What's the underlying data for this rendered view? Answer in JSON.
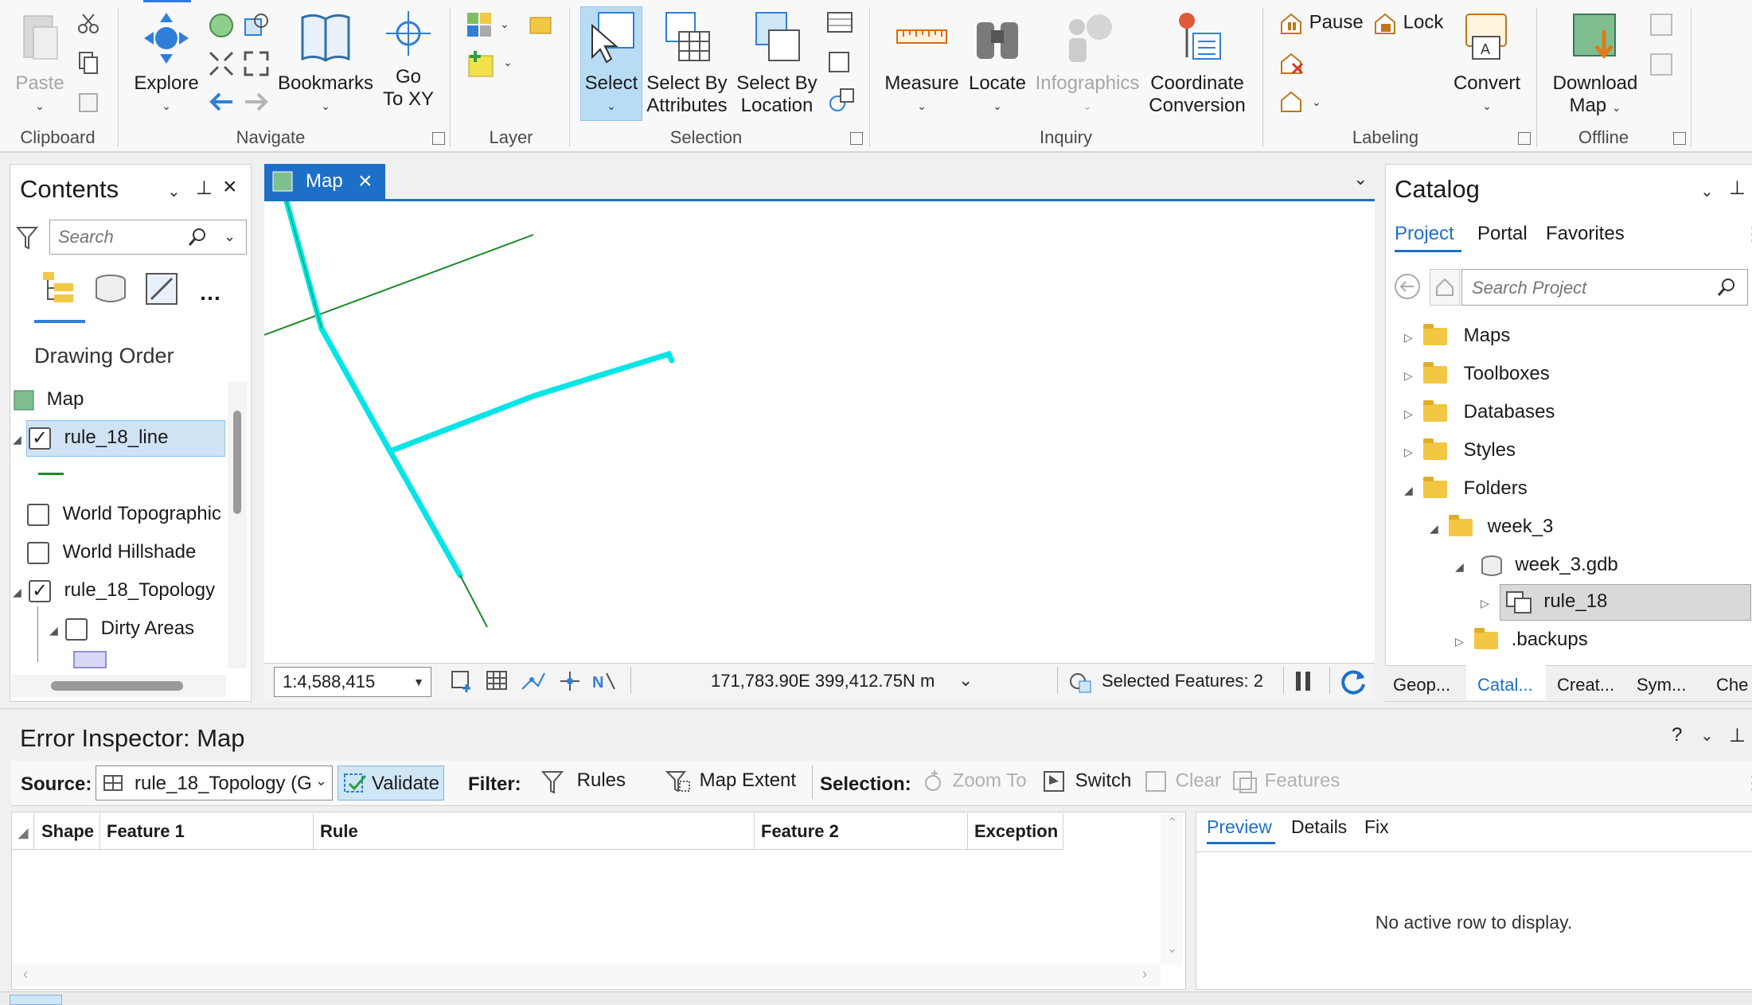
{
  "ribbon": {
    "clipboard": {
      "paste": "Paste",
      "group": "Clipboard"
    },
    "navigate": {
      "explore": "Explore",
      "bookmarks": "Bookmarks",
      "goto_line1": "Go",
      "goto_line2": "To XY",
      "group": "Navigate"
    },
    "layer": {
      "group": "Layer"
    },
    "selection": {
      "select": "Select",
      "by_attr_1": "Select By",
      "by_attr_2": "Attributes",
      "by_loc_1": "Select By",
      "by_loc_2": "Location",
      "group": "Selection"
    },
    "inquiry": {
      "measure": "Measure",
      "locate": "Locate",
      "infographics": "Infographics",
      "coord_1": "Coordinate",
      "coord_2": "Conversion",
      "group": "Inquiry"
    },
    "labeling": {
      "pause": "Pause",
      "lock": "Lock",
      "convert": "Convert",
      "group": "Labeling"
    },
    "offline": {
      "download_1": "Download",
      "download_2": "Map",
      "group": "Offline"
    }
  },
  "contents": {
    "title": "Contents",
    "search_placeholder": "Search",
    "drawing_order": "Drawing Order",
    "layers": [
      {
        "name": "Map"
      },
      {
        "name": "rule_18_line",
        "checked": true
      },
      {
        "name": "World Topographic",
        "checked": false
      },
      {
        "name": "World Hillshade",
        "checked": false
      },
      {
        "name": "rule_18_Topology",
        "checked": true
      },
      {
        "name": "Dirty Areas",
        "checked": false
      }
    ]
  },
  "map": {
    "tab": "Map",
    "scale": "1:4,588,415",
    "coords": "171,783.90E 399,412.75N m",
    "selected": "Selected Features: 2",
    "colors": {
      "selected_line": "#00e5e5",
      "line": "#1a8a2a"
    }
  },
  "catalog": {
    "title": "Catalog",
    "tabs": [
      "Project",
      "Portal",
      "Favorites"
    ],
    "search_placeholder": "Search Project",
    "items": [
      "Maps",
      "Toolboxes",
      "Databases",
      "Styles",
      "Folders",
      "week_3",
      "week_3.gdb",
      "rule_18",
      ".backups"
    ],
    "bottom_tabs": [
      "Geop...",
      "Catal...",
      "Creat...",
      "Sym...",
      "Che"
    ]
  },
  "error_inspector": {
    "title": "Error Inspector: Map",
    "source_label": "Source:",
    "source_value": "rule_18_Topology (G",
    "validate": "Validate",
    "filter_label": "Filter:",
    "rules": "Rules",
    "map_extent": "Map Extent",
    "selection_label": "Selection:",
    "zoom_to": "Zoom To",
    "switch": "Switch",
    "clear": "Clear",
    "features": "Features",
    "columns": [
      "Shape",
      "Feature 1",
      "Rule",
      "Feature 2",
      "Exception"
    ],
    "detail_tabs": [
      "Preview",
      "Details",
      "Fix"
    ],
    "empty": "No active row to display."
  },
  "window_controls": {
    "help": "?"
  }
}
